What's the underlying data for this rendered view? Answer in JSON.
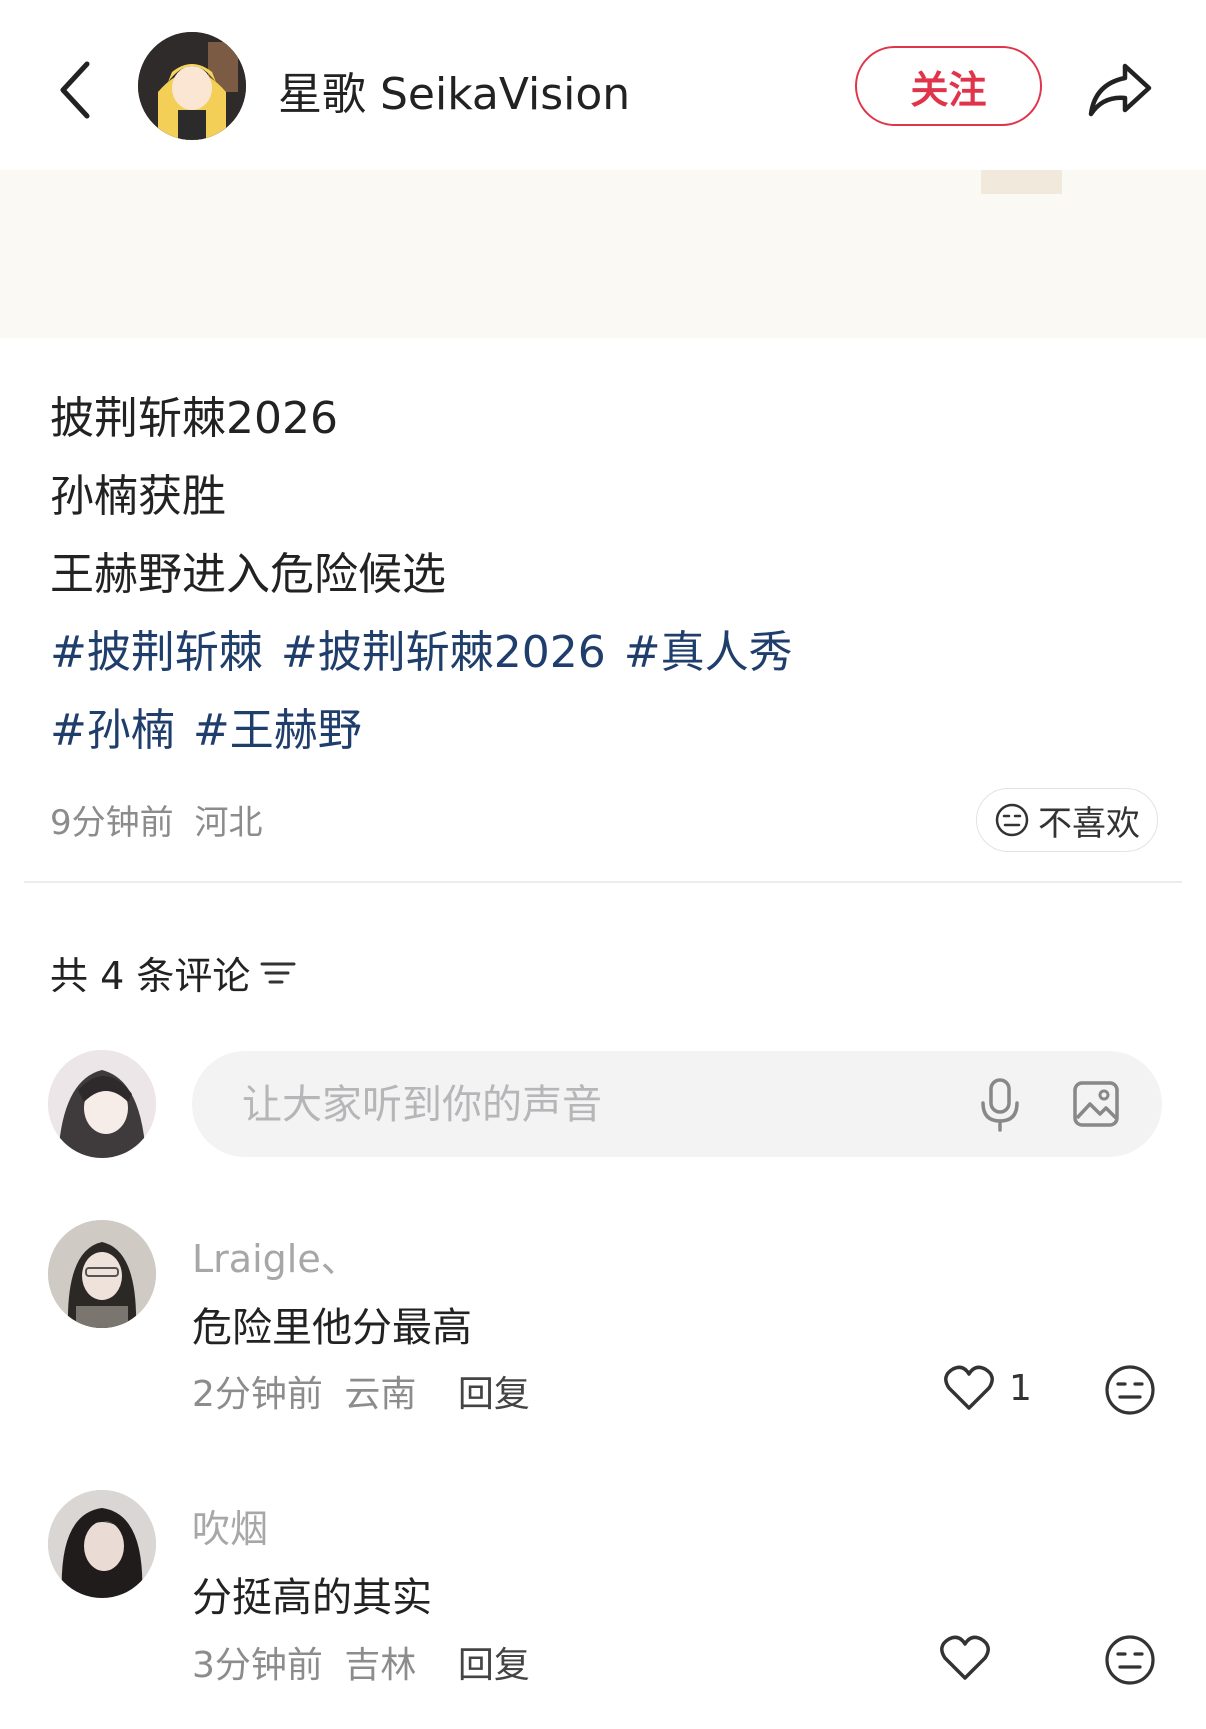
{
  "header": {
    "author_name": "星歌 SeikaVision",
    "follow_label": "关注"
  },
  "post": {
    "lines": [
      "披荆斩棘2026",
      "孙楠获胜",
      "王赫野进入危险候选"
    ],
    "tags": [
      "#披荆斩棘",
      "#披荆斩棘2026",
      "#真人秀",
      "#孙楠",
      "#王赫野"
    ],
    "time": "9分钟前",
    "location": "河北",
    "dislike_label": "不喜欢"
  },
  "comments_section": {
    "count_label": "共 4 条评论",
    "input_placeholder": "让大家听到你的声音"
  },
  "comments": [
    {
      "user": "Lraigle、",
      "text": "危险里他分最高",
      "time": "2分钟前",
      "location": "云南",
      "reply_label": "回复",
      "likes": "1"
    },
    {
      "user": "吹烟",
      "text": "分挺高的其实",
      "time": "3分钟前",
      "location": "吉林",
      "reply_label": "回复",
      "likes": ""
    }
  ],
  "colors": {
    "accent_red": "#e0344b",
    "tag_blue": "#1f3e6b",
    "muted": "#8c8c8c"
  },
  "icons": {
    "back": "chevron-left-icon",
    "share": "share-arrow-icon",
    "dislike": "meh-face-icon",
    "sort": "sort-lines-icon",
    "mic": "microphone-icon",
    "image": "image-icon",
    "like": "heart-icon"
  }
}
